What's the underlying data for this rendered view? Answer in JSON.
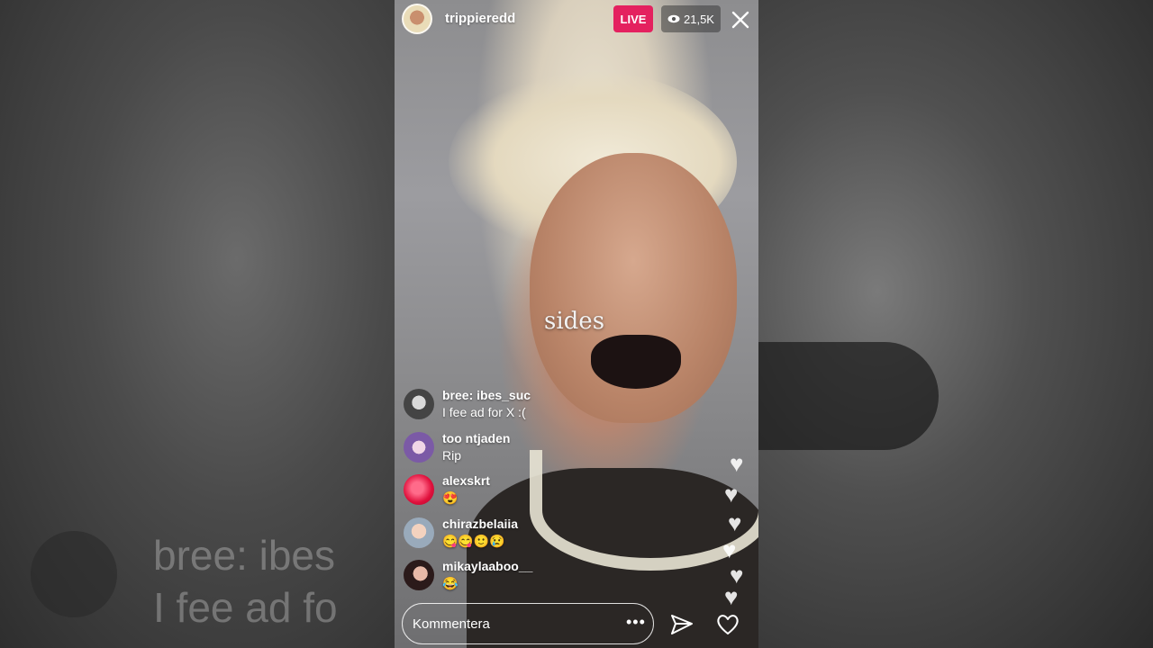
{
  "header": {
    "username": "trippieredd",
    "live_label": "LIVE",
    "viewer_count": "21,5K"
  },
  "video": {
    "caption_text": "sides"
  },
  "comments": [
    {
      "user": "bree:   ibes_suc",
      "text": "I fee   ad for X :("
    },
    {
      "user": "too    ntjaden",
      "text": "Rip"
    },
    {
      "user": "alexskrt",
      "text": "😍"
    },
    {
      "user": "chirazbelaiia",
      "text": "😋😋🙂😢"
    },
    {
      "user": "mikaylaaboo__",
      "text": "😂"
    }
  ],
  "footer": {
    "comment_placeholder": "Kommentera",
    "more_label": "•••"
  },
  "background": {
    "ghost_user": "bree:  ibes",
    "ghost_text": "I fee   ad fo"
  },
  "colors": {
    "live_badge": "#e4215f",
    "text": "#ffffff"
  },
  "icons": [
    "eye-icon",
    "close-icon",
    "send-icon",
    "heart-icon",
    "more-icon"
  ]
}
